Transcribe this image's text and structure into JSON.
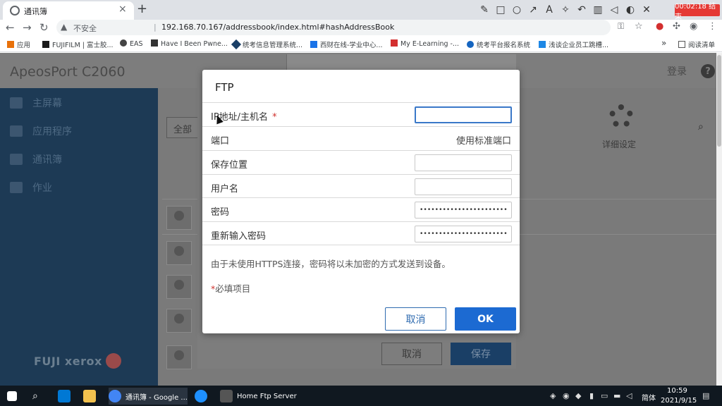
{
  "browser": {
    "tab_title": "通讯簿",
    "tab_close": "×",
    "new_tab": "+",
    "insecure_label": "不安全",
    "url": "192.168.70.167/addressbook/index.html#hashAddressBook",
    "record_badge": "00:02:18 结束"
  },
  "bookmarks": {
    "items": [
      {
        "label": "应用",
        "color": "#e8710a"
      },
      {
        "label": "FUJIFILM | 富士胶...",
        "color": "#1a1a1a"
      },
      {
        "label": "EAS",
        "color": "#444444"
      },
      {
        "label": "Have I Been Pwne...",
        "color": "#333333"
      },
      {
        "label": "统考信息管理系统...",
        "color": "#1a3f66"
      },
      {
        "label": "西财在线-学业中心...",
        "color": "#1a73e8"
      },
      {
        "label": "My E-Learning -...",
        "color": "#d32f2f"
      },
      {
        "label": "统考平台报名系统",
        "color": "#1565c0"
      },
      {
        "label": "浅谈企业员工跳槽...",
        "color": "#1e88e5"
      }
    ],
    "overflow": "»",
    "reading_list": "阅读清单"
  },
  "app": {
    "brand": "ApeosPort C2060",
    "login": "登录",
    "help": "?",
    "sidebar_items": [
      "主屏幕",
      "应用程序",
      "通讯簿",
      "作业"
    ],
    "logo_text": "FUJI xerox",
    "filter_label": "全部",
    "settings_label": "详细设定",
    "bg_cancel": "取消",
    "bg_save": "保存"
  },
  "dialog": {
    "title": "FTP",
    "fields": [
      {
        "label": "IP地址/主机名",
        "required": "*",
        "value": ""
      },
      {
        "label": "端口",
        "value_text": "使用标准端口"
      },
      {
        "label": "保存位置",
        "value": ""
      },
      {
        "label": "用户名",
        "value": ""
      },
      {
        "label": "密码",
        "value": "••••••••••••••••••••••••••••••••"
      },
      {
        "label": "重新输入密码",
        "value": "••••••••••••••••••••••••••••••••"
      }
    ],
    "note": "由于未使用HTTPS连接，密码将以未加密的方式发送到设备。",
    "required_star": "*",
    "required_note": "必填项目",
    "cancel_label": "取消",
    "ok_label": "OK"
  },
  "taskbar": {
    "apps": [
      {
        "label": "通讯簿 - Google ...",
        "color": "#4285f4"
      },
      {
        "label": "Home Ftp Server",
        "color": "#555555"
      }
    ],
    "ime": "简体",
    "time": "10:59",
    "date": "2021/9/15"
  }
}
